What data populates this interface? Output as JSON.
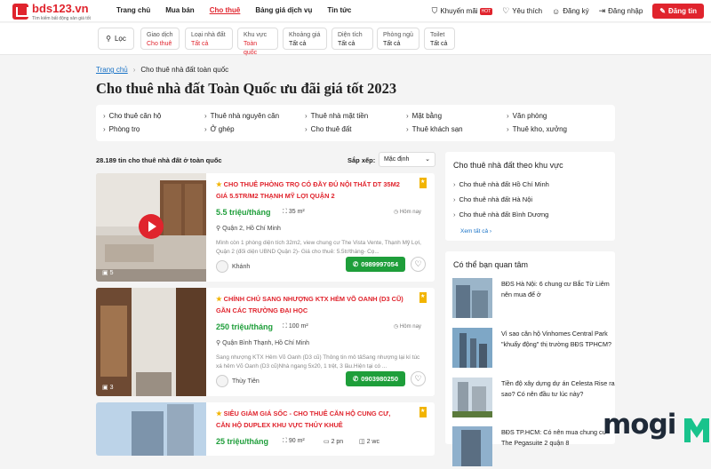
{
  "brand": {
    "name": "bds123.vn",
    "tagline": "Tìm kiếm bất động sản giá tốt",
    "accent": "#e0242d",
    "green": "#1e9e3a"
  },
  "nav": [
    "Trang chủ",
    "Mua bán",
    "Cho thuê",
    "Bảng giá dịch vụ",
    "Tin tức"
  ],
  "topright": {
    "promo": "Khuyến mãi",
    "promo_badge": "HOT",
    "fav": "Yêu thích",
    "register": "Đăng ký",
    "login": "Đăng nhập",
    "post": "Đăng tin"
  },
  "filters": {
    "location": "Lọc",
    "items": [
      {
        "label": "Giao dịch",
        "value": "Cho thuê"
      },
      {
        "label": "Loại nhà đất",
        "value": "Tất cả"
      },
      {
        "label": "Khu vực",
        "value": "Toàn quốc"
      },
      {
        "label": "Khoảng giá",
        "value": "Tất cả"
      },
      {
        "label": "Diện tích",
        "value": "Tất cả"
      },
      {
        "label": "Phòng ngủ",
        "value": "Tất cả"
      },
      {
        "label": "Toilet",
        "value": "Tất cả"
      }
    ]
  },
  "breadcrumb": {
    "home": "Trang chủ",
    "current": "Cho thuê nhà đất toàn quốc"
  },
  "page_title": "Cho thuê nhà đất Toàn Quốc ưu đãi giá tốt 2023",
  "categories": [
    "Cho thuê căn hộ",
    "Thuê nhà nguyên căn",
    "Thuê nhà mặt tiền",
    "Mặt bằng",
    "Văn phòng",
    "Phòng trọ",
    "Ở ghép",
    "Cho thuê đất",
    "Thuê khách sạn",
    "Thuê kho, xưởng"
  ],
  "results": {
    "count": "28.189 tin cho thuê nhà đất ở toàn quốc",
    "sort_label": "Sắp xếp:",
    "sort_value": "Mặc định"
  },
  "listings": [
    {
      "title": "CHO THUÊ PHÒNG TRỌ CÓ ĐẦY ĐỦ NỘI THẤT DT 35M2 GIÁ 5.5TR/M2 THẠNH MỸ LỢI QUẬN 2",
      "price": "5.5 triệu/tháng",
      "area": "35 m²",
      "time": "Hôm nay",
      "address": "Quận 2, Hồ Chí Minh",
      "desc": "Mình còn 1 phòng diện tích 32m2, view chung cư The Vista Vente, Thạnh Mỹ Lợi, Quận 2 (đối diện UBND Quận 2)- Giá cho thuê: 5.5tr/tháng- Cọ...",
      "photos": "5",
      "user": "Khánh",
      "phone": "0989997054"
    },
    {
      "title": "CHÍNH CHỦ SANG NHƯỢNG KTX HẺM VÕ OANH (D3 CŨ) GẦN CÁC TRƯỜNG ĐẠI HỌC",
      "price": "250 triệu/tháng",
      "area": "100 m²",
      "time": "Hôm nay",
      "address": "Quận Bình Thạnh, Hồ Chí Minh",
      "desc": "Sang nhượng KTX Hẻm Võ Oanh (D3 cũ) Thông tin mô tảSang nhượng lại kí túc xá hẻm Võ Oanh (D3 cũ)Nhà ngang 5x20, 1 trệt, 3 lầu.Hiện tại có ...",
      "photos": "3",
      "user": "Thùy Tiên",
      "phone": "0903980250"
    },
    {
      "title": "SIÊU GIẢM GIÁ SỐC - CHO THUÊ CĂN HỘ CUNG CƯ, CĂN HỘ DUPLEX KHU VỰC THỦY KHUÊ",
      "price": "25 triệu/tháng",
      "area": "90 m²",
      "beds": "2 pn",
      "baths": "2 wc"
    }
  ],
  "sidebar": {
    "regions_title": "Cho thuê nhà đất theo khu vực",
    "regions": [
      "Cho thuê nhà đất Hồ Chí Minh",
      "Cho thuê nhà đất Hà Nội",
      "Cho thuê nhà đất Bình Dương"
    ],
    "see_all": "Xem tất cả",
    "news_title": "Có thể bạn quan tâm",
    "news": [
      "BĐS Hà Nội: 6 chung cư Bắc Từ Liêm nên mua để ở",
      "Vì sao căn hộ Vinhomes Central Park \"khuấy động\" thị trường BĐS TPHCM?",
      "Tiền độ xây dựng dự án Celesta Rise ra sao? Có nên đầu tư lúc này?",
      "BĐS TP.HCM: Có nên mua chung cư The Pegasuite 2 quận 8"
    ]
  },
  "watermark": "mogi"
}
